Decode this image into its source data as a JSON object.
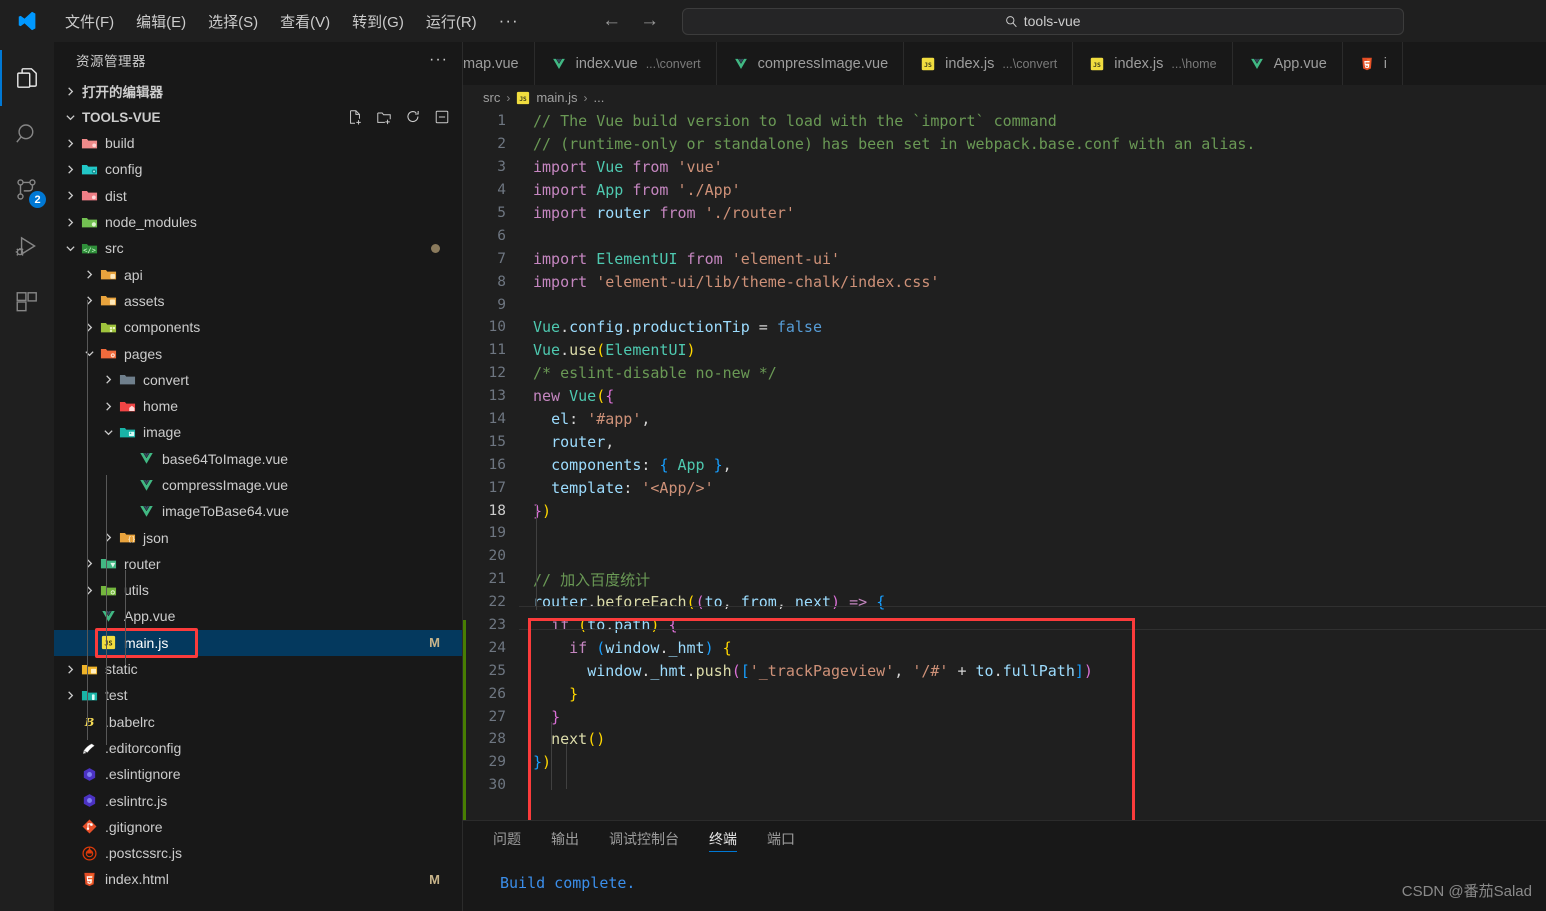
{
  "titlebar": {
    "logo_icon": "vscode-logo-icon",
    "menus": [
      "文件(F)",
      "编辑(E)",
      "选择(S)",
      "查看(V)",
      "转到(G)",
      "运行(R)"
    ],
    "overflow": "···",
    "back_icon": "arrow-left-icon",
    "forward_icon": "arrow-right-icon",
    "search": {
      "icon": "search-icon",
      "value": "tools-vue"
    }
  },
  "activitybar": {
    "items": [
      {
        "name": "explorer",
        "icon": "files-icon",
        "active": true,
        "badge": ""
      },
      {
        "name": "search",
        "icon": "search-icon",
        "active": false,
        "badge": ""
      },
      {
        "name": "source-control",
        "icon": "source-control-icon",
        "active": false,
        "badge": "2"
      },
      {
        "name": "run-and-debug",
        "icon": "run-debug-icon",
        "active": false,
        "badge": ""
      },
      {
        "name": "extensions",
        "icon": "extensions-icon",
        "active": false,
        "badge": ""
      }
    ]
  },
  "sidebar": {
    "title": "资源管理器",
    "more_icon": "ellipsis-icon",
    "open_editors_label": "打开的编辑器",
    "root_label": "TOOLS-VUE",
    "root_actions": [
      "new-file-icon",
      "new-folder-icon",
      "refresh-icon",
      "collapse-all-icon"
    ],
    "tree": [
      {
        "label": "build",
        "indent": 1,
        "arrow": "right",
        "icon": "folder-build",
        "badge": ""
      },
      {
        "label": "config",
        "indent": 1,
        "arrow": "right",
        "icon": "folder-config",
        "badge": ""
      },
      {
        "label": "dist",
        "indent": 1,
        "arrow": "right",
        "icon": "folder-dist",
        "badge": ""
      },
      {
        "label": "node_modules",
        "indent": 1,
        "arrow": "right",
        "icon": "folder-node",
        "badge": ""
      },
      {
        "label": "src",
        "indent": 1,
        "arrow": "down",
        "icon": "folder-src",
        "badge": "dot"
      },
      {
        "label": "api",
        "indent": 2,
        "arrow": "right",
        "icon": "folder-api",
        "badge": ""
      },
      {
        "label": "assets",
        "indent": 2,
        "arrow": "right",
        "icon": "folder-assets",
        "badge": ""
      },
      {
        "label": "components",
        "indent": 2,
        "arrow": "right",
        "icon": "folder-comp",
        "badge": ""
      },
      {
        "label": "pages",
        "indent": 2,
        "arrow": "down",
        "icon": "folder-pages",
        "badge": ""
      },
      {
        "label": "convert",
        "indent": 3,
        "arrow": "right",
        "icon": "folder-plain",
        "badge": ""
      },
      {
        "label": "home",
        "indent": 3,
        "arrow": "right",
        "icon": "folder-home",
        "badge": ""
      },
      {
        "label": "image",
        "indent": 3,
        "arrow": "down",
        "icon": "folder-image",
        "badge": ""
      },
      {
        "label": "base64ToImage.vue",
        "indent": 4,
        "arrow": "none",
        "icon": "vue-icon",
        "badge": ""
      },
      {
        "label": "compressImage.vue",
        "indent": 4,
        "arrow": "none",
        "icon": "vue-icon",
        "badge": ""
      },
      {
        "label": "imageToBase64.vue",
        "indent": 4,
        "arrow": "none",
        "icon": "vue-icon",
        "badge": ""
      },
      {
        "label": "json",
        "indent": 3,
        "arrow": "right",
        "icon": "folder-json",
        "badge": ""
      },
      {
        "label": "router",
        "indent": 2,
        "arrow": "right",
        "icon": "folder-router",
        "badge": ""
      },
      {
        "label": "utils",
        "indent": 2,
        "arrow": "right",
        "icon": "folder-utils",
        "badge": ""
      },
      {
        "label": "App.vue",
        "indent": 2,
        "arrow": "none",
        "icon": "vue-icon",
        "badge": ""
      },
      {
        "label": "main.js",
        "indent": 2,
        "arrow": "none",
        "icon": "js-icon",
        "badge": "M",
        "selected": true,
        "outlined": true
      },
      {
        "label": "static",
        "indent": 1,
        "arrow": "right",
        "icon": "folder-static",
        "badge": ""
      },
      {
        "label": "test",
        "indent": 1,
        "arrow": "right",
        "icon": "folder-test",
        "badge": ""
      },
      {
        "label": ".babelrc",
        "indent": 1,
        "arrow": "none",
        "icon": "babel-icon",
        "badge": ""
      },
      {
        "label": ".editorconfig",
        "indent": 1,
        "arrow": "none",
        "icon": "editorconfig-icon",
        "badge": ""
      },
      {
        "label": ".eslintignore",
        "indent": 1,
        "arrow": "none",
        "icon": "eslint-icon",
        "badge": ""
      },
      {
        "label": ".eslintrc.js",
        "indent": 1,
        "arrow": "none",
        "icon": "eslint-icon",
        "badge": ""
      },
      {
        "label": ".gitignore",
        "indent": 1,
        "arrow": "none",
        "icon": "git-icon",
        "badge": ""
      },
      {
        "label": ".postcssrc.js",
        "indent": 1,
        "arrow": "none",
        "icon": "postcss-icon",
        "badge": ""
      },
      {
        "label": "index.html",
        "indent": 1,
        "arrow": "none",
        "icon": "html-icon",
        "badge": "M"
      }
    ]
  },
  "editor": {
    "tabs": [
      {
        "label": "map.vue",
        "sub": "",
        "icon": "",
        "active": false,
        "partial": true
      },
      {
        "label": "index.vue",
        "sub": "...\\convert",
        "icon": "vue-icon",
        "active": false
      },
      {
        "label": "compressImage.vue",
        "sub": "",
        "icon": "vue-icon",
        "active": false
      },
      {
        "label": "index.js",
        "sub": "...\\convert",
        "icon": "js-icon",
        "active": false
      },
      {
        "label": "index.js",
        "sub": "...\\home",
        "icon": "js-icon",
        "active": false
      },
      {
        "label": "App.vue",
        "sub": "",
        "icon": "vue-icon",
        "active": false
      },
      {
        "label": "i",
        "sub": "",
        "icon": "html-icon",
        "active": false,
        "partial": true
      }
    ],
    "breadcrumb": {
      "folder": "src",
      "file": "main.js",
      "icon": "js-icon",
      "tail": "..."
    },
    "lines": [
      {
        "n": 1,
        "segs": [
          [
            "tk-comment",
            "// The Vue build version to load with the `import` command"
          ]
        ]
      },
      {
        "n": 2,
        "segs": [
          [
            "tk-comment",
            "// (runtime-only or standalone) has been set in webpack.base.conf with an alias."
          ]
        ]
      },
      {
        "n": 3,
        "segs": [
          [
            "tk-keyword",
            "import "
          ],
          [
            "tk-class",
            "Vue"
          ],
          [
            "tk-plain",
            " "
          ],
          [
            "tk-keyword",
            "from"
          ],
          [
            "tk-plain",
            " "
          ],
          [
            "tk-string",
            "'vue'"
          ]
        ]
      },
      {
        "n": 4,
        "segs": [
          [
            "tk-keyword",
            "import "
          ],
          [
            "tk-class",
            "App"
          ],
          [
            "tk-plain",
            " "
          ],
          [
            "tk-keyword",
            "from"
          ],
          [
            "tk-plain",
            " "
          ],
          [
            "tk-string",
            "'./App'"
          ]
        ]
      },
      {
        "n": 5,
        "segs": [
          [
            "tk-keyword",
            "import "
          ],
          [
            "tk-var",
            "router"
          ],
          [
            "tk-plain",
            " "
          ],
          [
            "tk-keyword",
            "from"
          ],
          [
            "tk-plain",
            " "
          ],
          [
            "tk-string",
            "'./router'"
          ]
        ]
      },
      {
        "n": 6,
        "segs": []
      },
      {
        "n": 7,
        "segs": [
          [
            "tk-keyword",
            "import "
          ],
          [
            "tk-class",
            "ElementUI"
          ],
          [
            "tk-plain",
            " "
          ],
          [
            "tk-keyword",
            "from"
          ],
          [
            "tk-plain",
            " "
          ],
          [
            "tk-string",
            "'element-ui'"
          ]
        ]
      },
      {
        "n": 8,
        "segs": [
          [
            "tk-keyword",
            "import "
          ],
          [
            "tk-string",
            "'element-ui/lib/theme-chalk/index.css'"
          ]
        ]
      },
      {
        "n": 9,
        "segs": []
      },
      {
        "n": 10,
        "segs": [
          [
            "tk-class",
            "Vue"
          ],
          [
            "tk-plain",
            "."
          ],
          [
            "tk-var",
            "config"
          ],
          [
            "tk-plain",
            "."
          ],
          [
            "tk-var",
            "productionTip"
          ],
          [
            "tk-plain",
            " = "
          ],
          [
            "tk-blue",
            "false"
          ]
        ]
      },
      {
        "n": 11,
        "segs": [
          [
            "tk-class",
            "Vue"
          ],
          [
            "tk-plain",
            "."
          ],
          [
            "tk-fn",
            "use"
          ],
          [
            "tk-br1",
            "("
          ],
          [
            "tk-class",
            "ElementUI"
          ],
          [
            "tk-br1",
            ")"
          ]
        ]
      },
      {
        "n": 12,
        "segs": [
          [
            "tk-comment",
            "/* eslint-disable no-new */"
          ]
        ]
      },
      {
        "n": 13,
        "segs": [
          [
            "tk-keyword",
            "new "
          ],
          [
            "tk-class",
            "Vue"
          ],
          [
            "tk-br1",
            "("
          ],
          [
            "tk-br2",
            "{"
          ]
        ]
      },
      {
        "n": 14,
        "segs": [
          [
            "tk-plain",
            "  "
          ],
          [
            "tk-var",
            "el"
          ],
          [
            "tk-plain",
            ": "
          ],
          [
            "tk-string",
            "'#app'"
          ],
          [
            "tk-plain",
            ","
          ]
        ]
      },
      {
        "n": 15,
        "segs": [
          [
            "tk-plain",
            "  "
          ],
          [
            "tk-var",
            "router"
          ],
          [
            "tk-plain",
            ","
          ]
        ]
      },
      {
        "n": 16,
        "segs": [
          [
            "tk-plain",
            "  "
          ],
          [
            "tk-var",
            "components"
          ],
          [
            "tk-plain",
            ": "
          ],
          [
            "tk-br3",
            "{"
          ],
          [
            "tk-plain",
            " "
          ],
          [
            "tk-class",
            "App"
          ],
          [
            "tk-plain",
            " "
          ],
          [
            "tk-br3",
            "}"
          ],
          [
            "tk-plain",
            ","
          ]
        ]
      },
      {
        "n": 17,
        "segs": [
          [
            "tk-plain",
            "  "
          ],
          [
            "tk-var",
            "template"
          ],
          [
            "tk-plain",
            ": "
          ],
          [
            "tk-string",
            "'<App/>'"
          ]
        ]
      },
      {
        "n": 18,
        "segs": [
          [
            "tk-br2",
            "}"
          ],
          [
            "tk-br1",
            ")"
          ]
        ]
      },
      {
        "n": 19,
        "segs": []
      },
      {
        "n": 20,
        "segs": []
      },
      {
        "n": 21,
        "segs": [
          [
            "tk-comment",
            "// 加入百度统计"
          ]
        ]
      },
      {
        "n": 22,
        "segs": [
          [
            "tk-var",
            "router"
          ],
          [
            "tk-plain",
            "."
          ],
          [
            "tk-fn",
            "beforeEach"
          ],
          [
            "tk-br1",
            "("
          ],
          [
            "tk-br2",
            "("
          ],
          [
            "tk-param",
            "to"
          ],
          [
            "tk-plain",
            ", "
          ],
          [
            "tk-param",
            "from"
          ],
          [
            "tk-plain",
            ", "
          ],
          [
            "tk-param",
            "next"
          ],
          [
            "tk-br2",
            ")"
          ],
          [
            "tk-plain",
            " "
          ],
          [
            "tk-keyword",
            "=>"
          ],
          [
            "tk-plain",
            " "
          ],
          [
            "tk-br3",
            "{"
          ]
        ]
      },
      {
        "n": 23,
        "segs": [
          [
            "tk-plain",
            "  "
          ],
          [
            "tk-keyword",
            "if"
          ],
          [
            "tk-plain",
            " "
          ],
          [
            "tk-br1",
            "("
          ],
          [
            "tk-var",
            "to"
          ],
          [
            "tk-plain",
            "."
          ],
          [
            "tk-var",
            "path"
          ],
          [
            "tk-br1",
            ")"
          ],
          [
            "tk-plain",
            " "
          ],
          [
            "tk-br2",
            "{"
          ]
        ]
      },
      {
        "n": 24,
        "segs": [
          [
            "tk-plain",
            "    "
          ],
          [
            "tk-keyword",
            "if"
          ],
          [
            "tk-plain",
            " "
          ],
          [
            "tk-br3",
            "("
          ],
          [
            "tk-var",
            "window"
          ],
          [
            "tk-plain",
            "."
          ],
          [
            "tk-var",
            "_hmt"
          ],
          [
            "tk-br3",
            ")"
          ],
          [
            "tk-plain",
            " "
          ],
          [
            "tk-br1",
            "{"
          ]
        ]
      },
      {
        "n": 25,
        "segs": [
          [
            "tk-plain",
            "      "
          ],
          [
            "tk-var",
            "window"
          ],
          [
            "tk-plain",
            "."
          ],
          [
            "tk-var",
            "_hmt"
          ],
          [
            "tk-plain",
            "."
          ],
          [
            "tk-fn",
            "push"
          ],
          [
            "tk-br2",
            "("
          ],
          [
            "tk-br3",
            "["
          ],
          [
            "tk-string",
            "'_trackPageview'"
          ],
          [
            "tk-plain",
            ", "
          ],
          [
            "tk-string",
            "'/#'"
          ],
          [
            "tk-plain",
            " + "
          ],
          [
            "tk-var",
            "to"
          ],
          [
            "tk-plain",
            "."
          ],
          [
            "tk-var",
            "fullPath"
          ],
          [
            "tk-br3",
            "]"
          ],
          [
            "tk-br2",
            ")"
          ]
        ]
      },
      {
        "n": 26,
        "segs": [
          [
            "tk-plain",
            "    "
          ],
          [
            "tk-br1",
            "}"
          ]
        ]
      },
      {
        "n": 27,
        "segs": [
          [
            "tk-plain",
            "  "
          ],
          [
            "tk-br2",
            "}"
          ]
        ]
      },
      {
        "n": 28,
        "segs": [
          [
            "tk-plain",
            "  "
          ],
          [
            "tk-fn",
            "next"
          ],
          [
            "tk-br1",
            "("
          ],
          [
            "tk-br1",
            ")"
          ]
        ]
      },
      {
        "n": 29,
        "segs": [
          [
            "tk-br3",
            "}"
          ],
          [
            "tk-br1",
            ")"
          ]
        ]
      },
      {
        "n": 30,
        "segs": []
      }
    ]
  },
  "panel": {
    "tabs": [
      "问题",
      "输出",
      "调试控制台",
      "终端",
      "端口"
    ],
    "active_tab": "终端",
    "terminal_output": "Build complete."
  },
  "watermark": "CSDN @番茄Salad",
  "colors": {
    "accent": "#0078d4",
    "selection": "#04395e",
    "highlight_box": "#fb3b3b",
    "terminal_text": "#3b8eea"
  }
}
